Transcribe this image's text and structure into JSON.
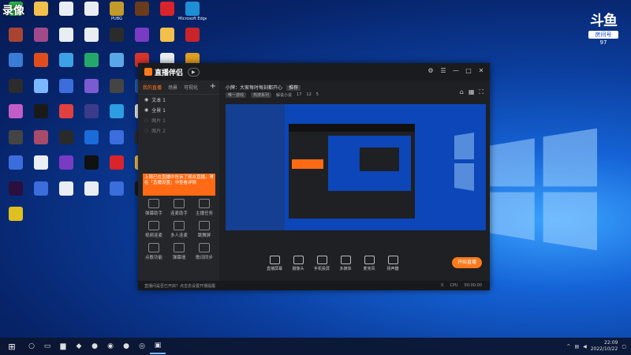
{
  "overlay": {
    "rec_label": "录像",
    "douyu_logo": "斗鱼",
    "room_label": "房间号",
    "room_number": "97"
  },
  "desktop_icons": [
    {
      "name": "wechat-icon",
      "label": "",
      "color": "#2bb24c"
    },
    {
      "name": "folder-icon",
      "label": "",
      "color": "#f3c04b"
    },
    {
      "name": "doc-icon",
      "label": "",
      "color": "#e9eef5"
    },
    {
      "name": "doc-icon",
      "label": "",
      "color": "#e9eef5"
    },
    {
      "name": "pubg-icon",
      "label": "PUBG",
      "color": "#c49a2a"
    },
    {
      "name": "game-icon",
      "label": "",
      "color": "#6a3b1d"
    },
    {
      "name": "netease-icon",
      "label": "",
      "color": "#d8242a"
    },
    {
      "name": "edge-icon",
      "label": "Microsoft Edge",
      "color": "#1e8fd6"
    },
    {
      "name": "app-icon",
      "label": "",
      "color": "#aa4432"
    },
    {
      "name": "app-icon",
      "label": "",
      "color": "#a04a8a"
    },
    {
      "name": "doc-icon",
      "label": "",
      "color": "#e9eef5"
    },
    {
      "name": "doc-icon",
      "label": "",
      "color": "#e9eef5"
    },
    {
      "name": "obs-icon",
      "label": "",
      "color": "#2b2b2b"
    },
    {
      "name": "app-icon",
      "label": "",
      "color": "#7a3bc4"
    },
    {
      "name": "folder-icon",
      "label": "",
      "color": "#f3c04b"
    },
    {
      "name": "app-icon",
      "label": "",
      "color": "#c8242a"
    },
    {
      "name": "app-icon",
      "label": "",
      "color": "#3a7bd5"
    },
    {
      "name": "app-icon",
      "label": "",
      "color": "#e04d1d"
    },
    {
      "name": "app-icon",
      "label": "",
      "color": "#3ea1e6"
    },
    {
      "name": "app-icon",
      "label": "",
      "color": "#24a86a"
    },
    {
      "name": "app-icon",
      "label": "",
      "color": "#5aa7e8"
    },
    {
      "name": "app-icon",
      "label": "",
      "color": "#d9342b"
    },
    {
      "name": "doc-icon",
      "label": "",
      "color": "#e9eef5"
    },
    {
      "name": "app-icon",
      "label": "",
      "color": "#e0a020"
    },
    {
      "name": "app-icon",
      "label": "",
      "color": "#2c2c2c"
    },
    {
      "name": "app-icon",
      "label": "",
      "color": "#7ab7ff"
    },
    {
      "name": "app-icon",
      "label": "",
      "color": "#3b6ddc"
    },
    {
      "name": "app-icon",
      "label": "",
      "color": "#7a5bd1"
    },
    {
      "name": "app-icon",
      "label": "",
      "color": "#444"
    },
    {
      "name": "app-icon",
      "label": "",
      "color": "#2b5da8"
    },
    {
      "name": "app-icon",
      "label": "",
      "color": "#ee8a24"
    },
    {
      "name": "app-icon",
      "label": "",
      "color": "#2b8ad8"
    },
    {
      "name": "app-icon",
      "label": "",
      "color": "#c25cc8"
    },
    {
      "name": "app-icon",
      "label": "",
      "color": "#1a1a1a"
    },
    {
      "name": "app-icon",
      "label": "",
      "color": "#e04040"
    },
    {
      "name": "app-icon",
      "label": "",
      "color": "#3b3b8b"
    },
    {
      "name": "app-icon",
      "label": "",
      "color": "#2b9de0"
    },
    {
      "name": "app-icon",
      "label": "",
      "color": "#f0f0f0"
    },
    {
      "name": "app-icon",
      "label": "",
      "color": "#e02020"
    },
    {
      "name": "app-icon",
      "label": "",
      "color": "#29a0f0"
    },
    {
      "name": "app-icon",
      "label": "",
      "color": "#444"
    },
    {
      "name": "app-icon",
      "label": "",
      "color": "#a84a6a"
    },
    {
      "name": "app-icon",
      "label": "",
      "color": "#2a2a2a"
    },
    {
      "name": "app-icon",
      "label": "",
      "color": "#1b6bd8"
    },
    {
      "name": "app-icon",
      "label": "",
      "color": "#3b6ddc"
    },
    {
      "name": "app-icon",
      "label": "",
      "color": "#2b2b2b"
    },
    {
      "name": "app-icon",
      "label": "",
      "color": "#1a1a1a"
    },
    {
      "name": "app-icon",
      "label": "",
      "color": "#24a86a"
    },
    {
      "name": "app-icon",
      "label": "",
      "color": "#3b6ddc"
    },
    {
      "name": "app-icon",
      "label": "",
      "color": "#e9eef5"
    },
    {
      "name": "app-icon",
      "label": "",
      "color": "#7a3bc4"
    },
    {
      "name": "app-icon",
      "label": "",
      "color": "#111"
    },
    {
      "name": "app-icon",
      "label": "",
      "color": "#d8242a"
    },
    {
      "name": "app-icon",
      "label": "",
      "color": "#f3c04b"
    },
    {
      "name": "app-icon",
      "label": "",
      "color": "#3a3a3a"
    },
    {
      "name": "app-icon",
      "label": "",
      "color": "#2b2b2b"
    },
    {
      "name": "premiere-icon",
      "label": "",
      "color": "#2a0f3f"
    },
    {
      "name": "app-icon",
      "label": "",
      "color": "#3b6ddc"
    },
    {
      "name": "app-icon",
      "label": "",
      "color": "#e9eef5"
    },
    {
      "name": "app-icon",
      "label": "",
      "color": "#e9eef5"
    },
    {
      "name": "app-icon",
      "label": "",
      "color": "#3b6ddc"
    },
    {
      "name": "app-icon",
      "label": "",
      "color": "#1a1a1a"
    },
    {
      "name": "illustrator-icon",
      "label": "",
      "color": "#3b1a00"
    },
    {
      "name": "wechat-icon",
      "label": "",
      "color": "#2bb24c"
    },
    {
      "name": "app-icon",
      "label": "",
      "color": "#e0c020"
    }
  ],
  "app": {
    "title": "直播伴侣",
    "tabs": [
      "我的直播",
      "场景",
      "可视化"
    ],
    "scenes": [
      "文本 1",
      "全景 1",
      "图片 1",
      "图片 2"
    ],
    "notice": "上周已在直播中告诉了观众直播，可在「直播设置」中查看详情",
    "tools": [
      "弹幕助手",
      "连麦助手",
      "主播任务",
      "视频连麦",
      "多人连麦",
      "跳舞屏",
      "点歌功能",
      "弹幕墙",
      "歌词同步"
    ],
    "room_title": "小牌：大家每时每刻都开心",
    "room_tag": "推荐",
    "room_sub": [
      "唯一游戏",
      "热搜系列",
      "解说小说",
      "17",
      "12",
      "5"
    ],
    "controls": [
      "直播屏幕",
      "摄像头",
      "手机投屏",
      "多媒体",
      "麦克风",
      "扬声器"
    ],
    "go_live": "开始直播",
    "bottom_tip": "直播间是否已开启？点击去设置开播提醒",
    "stats": [
      "0",
      "CPU",
      "00:00:00"
    ]
  },
  "taskbar": {
    "time": "22:09",
    "date": "2022/10/22"
  }
}
